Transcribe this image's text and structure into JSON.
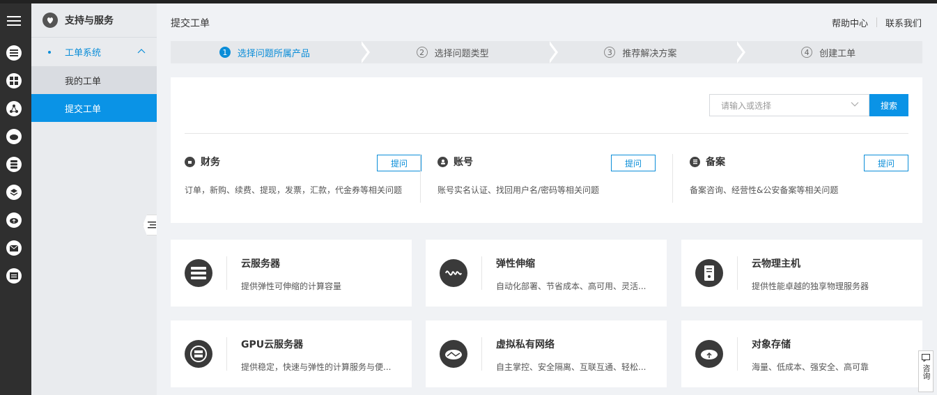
{
  "sidebar": {
    "title": "支持与服务",
    "group": "工单系统",
    "items": [
      "我的工单",
      "提交工单"
    ]
  },
  "header": {
    "page_title": "提交工单",
    "links": [
      "帮助中心",
      "联系我们"
    ]
  },
  "steps": [
    {
      "num": "1",
      "label": "选择问题所属产品",
      "active": true
    },
    {
      "num": "2",
      "label": "选择问题类型",
      "active": false
    },
    {
      "num": "3",
      "label": "推荐解决方案",
      "active": false
    },
    {
      "num": "4",
      "label": "创建工单",
      "active": false
    }
  ],
  "search": {
    "placeholder": "请输入或选择",
    "button": "搜索"
  },
  "categories": [
    {
      "title": "财务",
      "ask": "提问",
      "desc": "订单，新购、续费、提现，发票，汇款，代金券等相关问题",
      "icon": "money-icon"
    },
    {
      "title": "账号",
      "ask": "提问",
      "desc": "账号实名认证、找回用户名/密码等相关问题",
      "icon": "user-icon"
    },
    {
      "title": "备案",
      "ask": "提问",
      "desc": "备案咨询、经营性&公安备案等相关问题",
      "icon": "record-icon"
    }
  ],
  "products": [
    {
      "title": "云服务器",
      "desc": "提供弹性可伸缩的计算容量",
      "icon": "server-icon"
    },
    {
      "title": "弹性伸缩",
      "desc": "自动化部署、节省成本、高可用、灵活...",
      "icon": "scaling-icon"
    },
    {
      "title": "云物理主机",
      "desc": "提供性能卓越的独享物理服务器",
      "icon": "physical-host-icon"
    },
    {
      "title": "GPU云服务器",
      "desc": "提供稳定，快速与弹性的计算服务与便...",
      "icon": "gpu-icon"
    },
    {
      "title": "虚拟私有网络",
      "desc": "自主掌控、安全隔离、互联互通、轻松...",
      "icon": "vpc-icon"
    },
    {
      "title": "对象存储",
      "desc": "海量、低成本、强安全、高可靠",
      "icon": "object-storage-icon"
    }
  ],
  "consult": "咨询",
  "colors": {
    "accent": "#0a93e6",
    "rail": "#2f2f2f"
  }
}
